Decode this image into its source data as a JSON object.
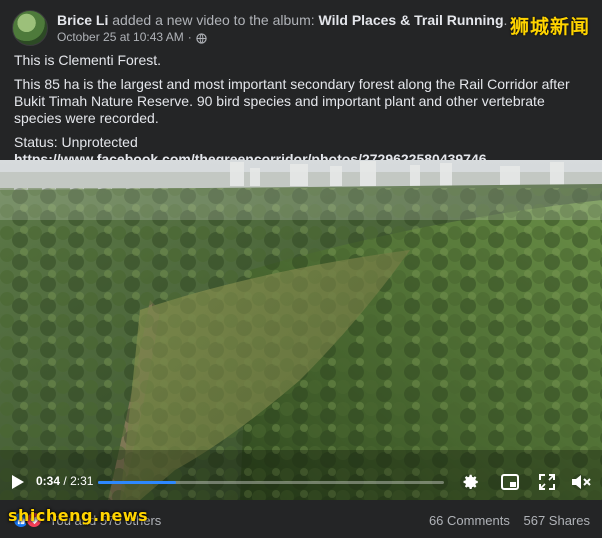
{
  "post": {
    "author": "Brice Li",
    "action_text": "added a new video to the album:",
    "album": "Wild Places & Trail Running",
    "album_suffix": ".",
    "timestamp": "October 25 at 10:43 AM",
    "separator": "·",
    "paragraph1": "This is Clementi Forest.",
    "paragraph2": "This 85 ha is the largest and most important secondary forest along the Rail Corridor after Bukit Timah Nature Reserve. 90 bird species and important plant and other vertebrate species were recorded.",
    "status_label": "Status: Unprotected",
    "status_link": "https://www.facebook.com/thegreencorridor/photos/2729622580439746"
  },
  "video": {
    "current_time": "0:34",
    "duration_separator": "/",
    "duration": "2:31",
    "progress_fraction": 0.225,
    "icons": [
      "play-icon",
      "settings-icon",
      "picture-in-picture-icon",
      "fullscreen-icon",
      "mute-icon"
    ]
  },
  "footer": {
    "reactions_text": "You and 578 others",
    "comments": "66 Comments",
    "shares": "567 Shares"
  },
  "watermarks": {
    "top": "狮城新闻",
    "bottom": "shicheng.news"
  },
  "colors": {
    "background": "#242526",
    "primary_text": "#e4e6eb",
    "secondary_text": "#b0b3b8",
    "accent": "#2d88ff",
    "watermark": "#ffd400"
  }
}
